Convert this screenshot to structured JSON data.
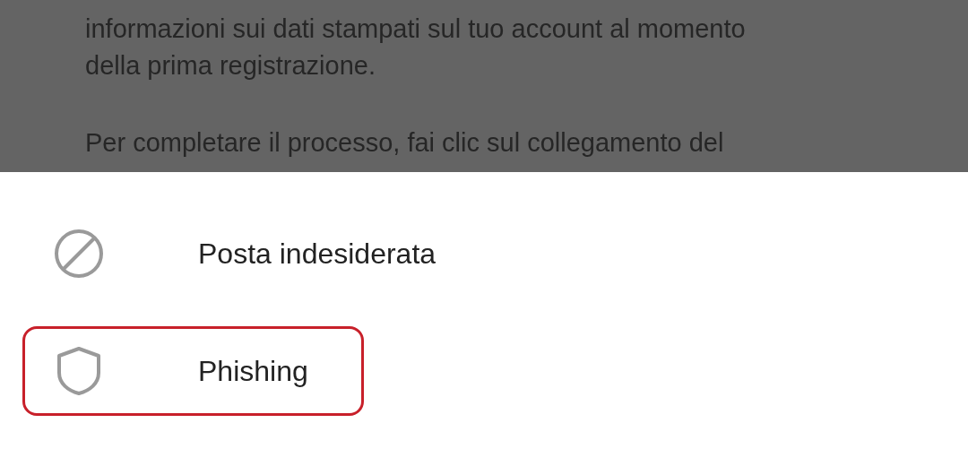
{
  "email_body": {
    "paragraphs": [
      {
        "lines": [
          "informazioni sui dati stampati sul tuo account al momento",
          "della prima registrazione."
        ]
      },
      {
        "lines": [
          "Per completare il processo, fai clic sul collegamento del"
        ]
      }
    ]
  },
  "menu": {
    "items": [
      {
        "kind": "spam",
        "label": "Posta indesiderata",
        "highlighted": false
      },
      {
        "kind": "phishing",
        "label": "Phishing",
        "highlighted": true
      }
    ]
  }
}
